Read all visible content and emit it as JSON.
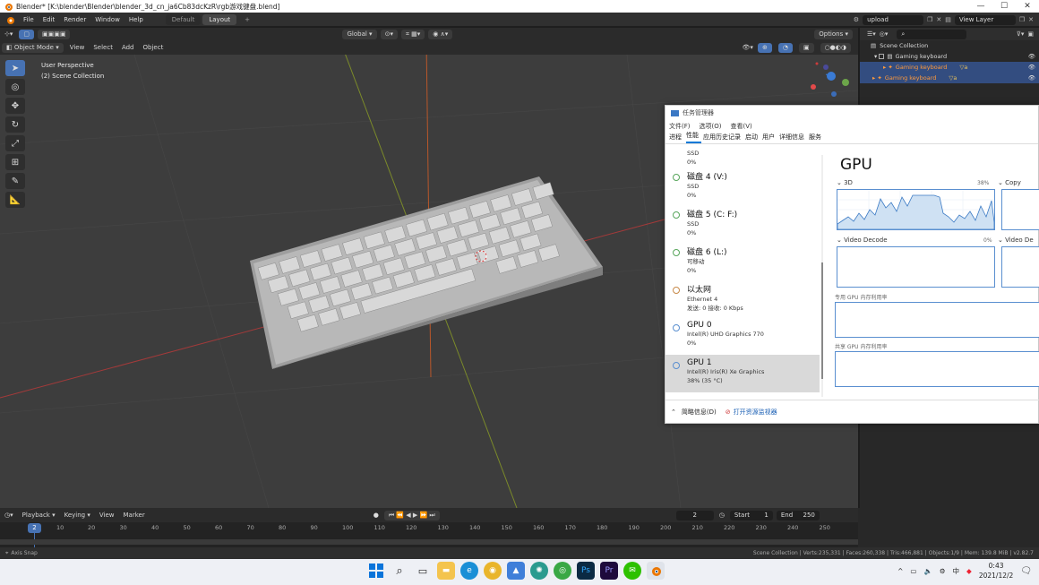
{
  "window": {
    "title": "Blender* [K:\\blender\\Blender\\blender_3d_cn_ja6Cb83dcKzR\\rgb游戏键盘.blend]",
    "minimize": "—",
    "maximize": "☐",
    "close": "✕"
  },
  "menubar": {
    "items": [
      "File",
      "Edit",
      "Render",
      "Window",
      "Help"
    ],
    "workspaces": [
      "Default",
      "Layout"
    ],
    "active_workspace": "Layout",
    "add_tab": "+",
    "scene_name": "upload",
    "view_layer": "View Layer"
  },
  "viewport_header": {
    "orientation": "Global",
    "options": "Options"
  },
  "viewport_header2": {
    "mode": "Object Mode",
    "menus": [
      "View",
      "Select",
      "Add",
      "Object"
    ]
  },
  "viewport": {
    "perspective": "User Perspective",
    "collection": "(2) Scene Collection",
    "tools": [
      "cursor-select",
      "cursor",
      "move",
      "rotate",
      "scale",
      "transform",
      "annotate",
      "measure"
    ]
  },
  "outliner": {
    "root": "Scene Collection",
    "rows": [
      {
        "label": "Gaming keyboard",
        "selected": false
      },
      {
        "label": "Gaming keyboard",
        "selected": true
      },
      {
        "label": "Gaming keyboard",
        "selected": true
      }
    ]
  },
  "task_manager": {
    "title": "任务管理器",
    "menu": [
      "文件(F)",
      "选项(O)",
      "查看(V)"
    ],
    "tabs": [
      "进程",
      "性能",
      "应用历史记录",
      "启动",
      "用户",
      "详细信息",
      "服务"
    ],
    "active_tab": "性能",
    "devices": [
      {
        "name": "",
        "sub1": "SSD",
        "sub2": "0%",
        "partial": true
      },
      {
        "name": "磁盘 4 (V:)",
        "sub1": "SSD",
        "sub2": "0%"
      },
      {
        "name": "磁盘 5 (C: F:)",
        "sub1": "SSD",
        "sub2": "0%"
      },
      {
        "name": "磁盘 6 (L:)",
        "sub1": "可移动",
        "sub2": "0%"
      },
      {
        "name": "以太网",
        "sub1": "Ethernet 4",
        "sub2": "发送: 0 接收: 0 Kbps"
      },
      {
        "name": "GPU 0",
        "sub1": "Intel(R) UHD Graphics 770",
        "sub2": "0%"
      },
      {
        "name": "GPU 1",
        "sub1": "Intel(R) Iris(R) Xe Graphics",
        "sub2": "38% (35 °C)"
      }
    ],
    "panel": {
      "heading": "GPU",
      "engine1": "3D",
      "engine1_pct": "38%",
      "engine2": "Copy",
      "engine3": "Video Decode",
      "engine3_pct": "0%",
      "engine4": "Video De",
      "mem1": "专用 GPU 内存利用率",
      "mem2": "共享 GPU 内存利用率"
    },
    "footer": {
      "summary": "简略信息(D)",
      "open_monitor": "打开资源监视器"
    }
  },
  "timeline": {
    "menus": [
      "Playback",
      "Keying",
      "View",
      "Marker"
    ],
    "current_frame": "2",
    "start_label": "Start",
    "start": "1",
    "end_label": "End",
    "end": "250",
    "ticks": [
      "20",
      "30",
      "40",
      "50",
      "60",
      "70",
      "80",
      "90",
      "100",
      "110",
      "120",
      "130",
      "140",
      "150",
      "160",
      "170",
      "180",
      "190",
      "200",
      "210",
      "220",
      "230",
      "240",
      "250"
    ],
    "first_tick": "10",
    "indicator": "2"
  },
  "statusbar": {
    "left": "Axis Snap",
    "right": "Scene Collection | Verts:235,331 | Faces:260,338 | Tris:466,881 | Objects:1/9 | Mem: 139.8 MiB | v2.82.7"
  },
  "taskbar": {
    "time": "0:43",
    "date": "2021/12/2",
    "tray_text": "^"
  }
}
